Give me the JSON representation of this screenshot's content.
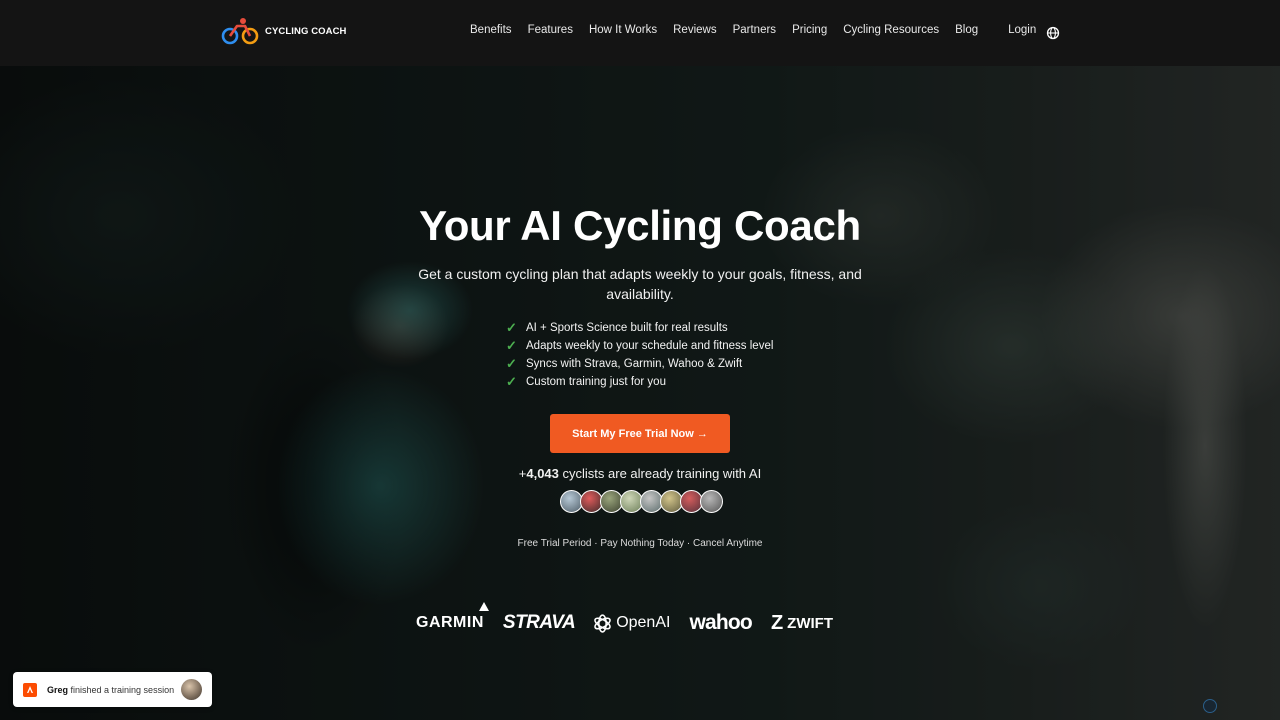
{
  "brand": {
    "name": "CYCLING COACH"
  },
  "nav": {
    "items": [
      {
        "label": "Benefits"
      },
      {
        "label": "Features"
      },
      {
        "label": "How It Works"
      },
      {
        "label": "Reviews"
      },
      {
        "label": "Partners"
      },
      {
        "label": "Pricing"
      },
      {
        "label": "Cycling Resources"
      },
      {
        "label": "Blog"
      }
    ],
    "login_label": "Login",
    "language_icon": "globe-icon"
  },
  "hero": {
    "title": "Your AI Cycling Coach",
    "subtitle": "Get a custom cycling plan that adapts weekly to your goals, fitness, and availability.",
    "features": [
      {
        "text": "AI + Sports Science built for real results"
      },
      {
        "text": "Adapts weekly to your schedule and fitness level"
      },
      {
        "text": "Syncs with Strava, Garmin, Wahoo & Zwift"
      },
      {
        "text": "Custom training just for you"
      }
    ],
    "check_icon": "✓",
    "cta_label": "Start My Free Trial Now →",
    "count_prefix": "+",
    "count_value": "4,043",
    "count_suffix": " cyclists are already training with AI",
    "fine_print": "Free Trial Period · Pay Nothing Today · Cancel Anytime"
  },
  "partners": {
    "garmin": "GARMIN",
    "strava": "STRAVA",
    "openai": "OpenAI",
    "wahoo": "wahoo",
    "zwift": "ZWIFT"
  },
  "toast": {
    "name": "Greg",
    "message": " finished a training session"
  },
  "colors": {
    "accent": "#f05a22",
    "check": "#4caf50",
    "nav_bg": "#141414"
  }
}
